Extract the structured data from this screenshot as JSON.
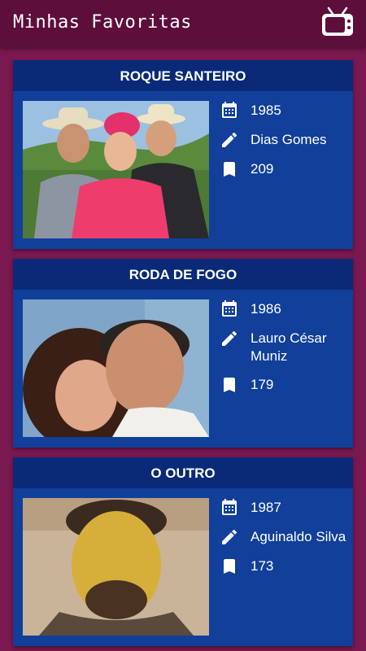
{
  "appbar": {
    "title": "Minhas Favoritas",
    "icon": "tv-icon"
  },
  "novelas": [
    {
      "title": "ROQUE SANTEIRO",
      "year": "1985",
      "author": "Dias Gomes",
      "episodes": "209"
    },
    {
      "title": "RODA DE FOGO",
      "year": "1986",
      "author": "Lauro César Muniz",
      "episodes": "179"
    },
    {
      "title": "O OUTRO",
      "year": "1987",
      "author": "Aguinaldo Silva",
      "episodes": "173"
    }
  ],
  "colors": {
    "background": "#7a1850",
    "appbar": "#5e0e3a",
    "card": "#113f9a",
    "card_header": "#0a2a78",
    "text": "#ffffff"
  },
  "icons": {
    "year": "calendar-icon",
    "author": "pencil-icon",
    "episodes": "bookmark-icon"
  }
}
